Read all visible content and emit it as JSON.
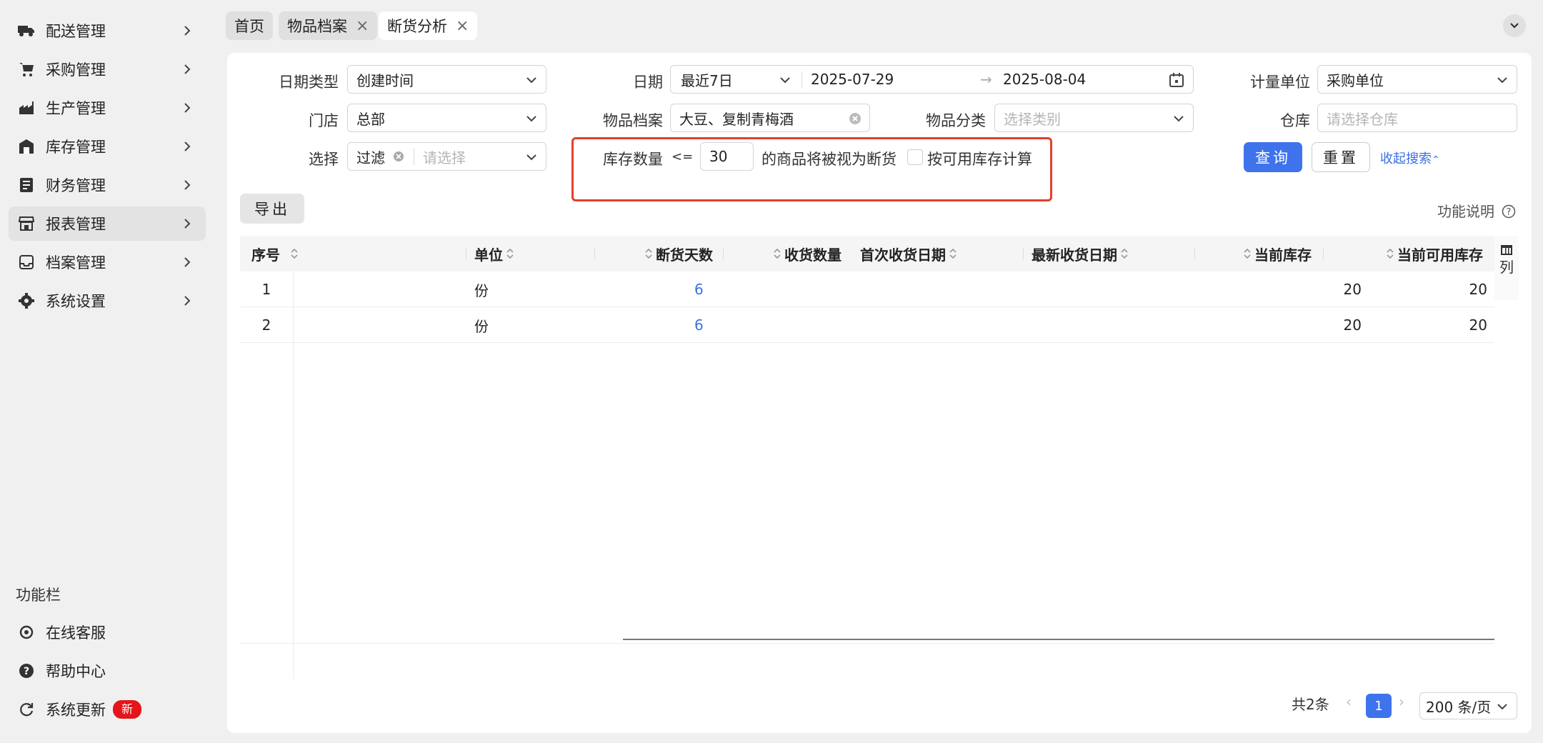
{
  "sidebar": {
    "items": [
      {
        "label": "配送管理",
        "icon": "truck-icon"
      },
      {
        "label": "采购管理",
        "icon": "cart-icon"
      },
      {
        "label": "生产管理",
        "icon": "factory-icon"
      },
      {
        "label": "库存管理",
        "icon": "warehouse-icon"
      },
      {
        "label": "财务管理",
        "icon": "ledger-icon"
      },
      {
        "label": "报表管理",
        "icon": "store-report-icon"
      },
      {
        "label": "档案管理",
        "icon": "inbox-icon"
      },
      {
        "label": "系统设置",
        "icon": "gear-icon"
      }
    ],
    "active_index": 5,
    "func_title": "功能栏",
    "func_items": [
      {
        "label": "在线客服",
        "icon": "headset-icon"
      },
      {
        "label": "帮助中心",
        "icon": "help-icon"
      },
      {
        "label": "系统更新",
        "icon": "refresh-icon",
        "badge": "新"
      }
    ]
  },
  "tabs": [
    {
      "label": "首页",
      "closable": false
    },
    {
      "label": "物品档案",
      "closable": true
    },
    {
      "label": "断货分析",
      "closable": true,
      "active": true
    }
  ],
  "filters": {
    "date_type_label": "日期类型",
    "date_type_value": "创建时间",
    "date_label": "日期",
    "date_range_preset": "最近7日",
    "date_start": "2025-07-29",
    "date_end": "2025-08-04",
    "unit_label": "计量单位",
    "unit_value": "采购单位",
    "store_label": "门店",
    "store_value": "总部",
    "item_label": "物品档案",
    "item_value": "大豆、复制青梅酒",
    "category_label": "物品分类",
    "category_placeholder": "选择类别",
    "warehouse_label": "仓库",
    "warehouse_placeholder": "请选择仓库",
    "select_label": "选择",
    "select_tag": "过滤",
    "select_placeholder": "请选择",
    "stock_qty_label": "库存数量",
    "stock_op": "<=",
    "stock_value": "30",
    "stock_suffix": "的商品将被视为断货",
    "available_checkbox_label": "按可用库存计算",
    "available_checked": false
  },
  "actions": {
    "query": "查询",
    "reset": "重置",
    "collapse": "收起搜索",
    "export": "导出",
    "help": "功能说明"
  },
  "table": {
    "columns": [
      "序号",
      "单位",
      "断货天数",
      "收货数量",
      "首次收货日期",
      "最新收货日期",
      "当前库存",
      "当前可用库存"
    ],
    "rows": [
      {
        "index": "1",
        "unit": "份",
        "days": "6",
        "received": "",
        "first_date": "",
        "latest_date": "",
        "stock": "20",
        "available": "20"
      },
      {
        "index": "2",
        "unit": "份",
        "days": "6",
        "received": "",
        "first_date": "",
        "latest_date": "",
        "stock": "20",
        "available": "20"
      }
    ],
    "column_toggle": "列"
  },
  "pagination": {
    "total": "共2条",
    "current_page": "1",
    "page_size": "200 条/页"
  },
  "colors": {
    "primary": "#3f73ec",
    "highlight_border": "#e0402e",
    "badge": "#e4161b"
  }
}
